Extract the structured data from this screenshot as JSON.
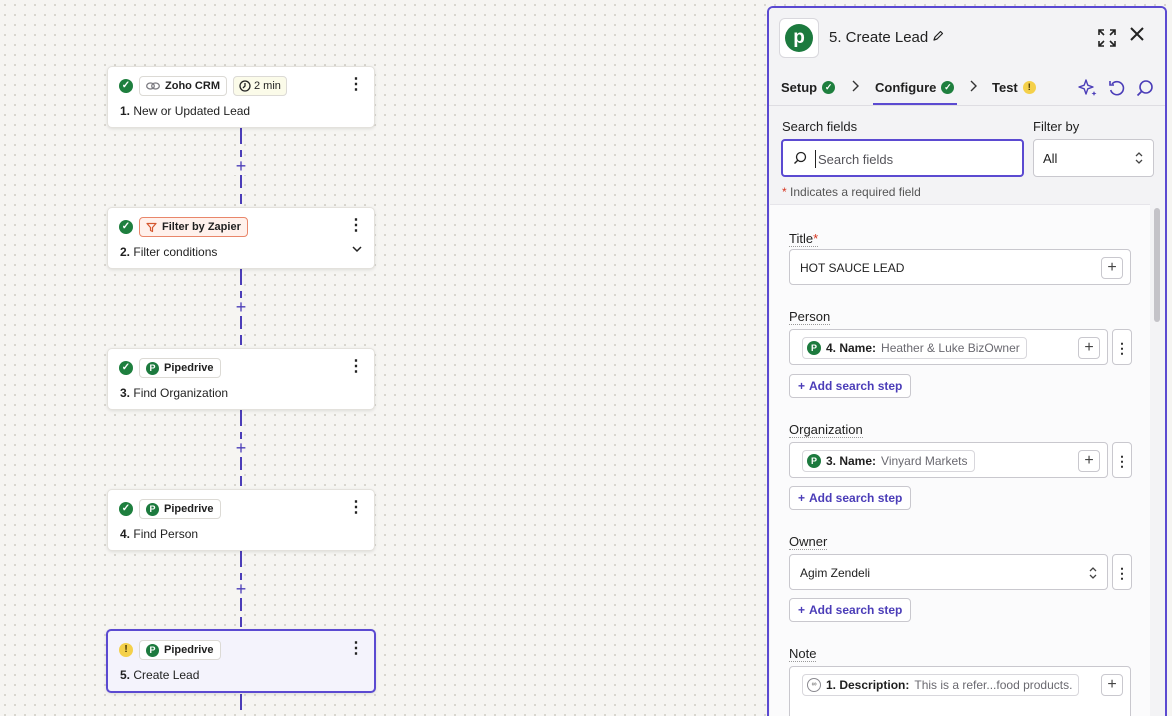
{
  "canvas": {
    "steps": [
      {
        "number": "1.",
        "title": "New or Updated Lead",
        "app": "Zoho CRM",
        "status": "ok",
        "extra": "2 min"
      },
      {
        "number": "2.",
        "title": "Filter conditions",
        "app": "Filter by Zapier",
        "status": "ok"
      },
      {
        "number": "3.",
        "title": "Find Organization",
        "app": "Pipedrive",
        "status": "ok"
      },
      {
        "number": "4.",
        "title": "Find Person",
        "app": "Pipedrive",
        "status": "ok"
      },
      {
        "number": "5.",
        "title": "Create Lead",
        "app": "Pipedrive",
        "status": "warning"
      }
    ],
    "add_step_symbol": "+",
    "kebab_symbol": "⋮"
  },
  "panel": {
    "title": "5. Create Lead",
    "tabs": [
      {
        "label": "Setup",
        "status": "ok"
      },
      {
        "label": "Configure",
        "status": "ok"
      },
      {
        "label": "Test",
        "status": "warning"
      }
    ],
    "search_label": "Search fields",
    "search_placeholder": "Search fields",
    "filter_label": "Filter by",
    "filter_value": "All",
    "required_note": "Indicates a required field",
    "required_star": "*",
    "fields": {
      "title": {
        "label": "Title",
        "value": "HOT SAUCE LEAD"
      },
      "person": {
        "label": "Person",
        "pill_key": "4. Name:",
        "pill_value": "Heather & Luke BizOwner"
      },
      "organization": {
        "label": "Organization",
        "pill_key": "3. Name:",
        "pill_value": "Vinyard Markets"
      },
      "owner": {
        "label": "Owner",
        "value": "Agim Zendeli"
      },
      "note": {
        "label": "Note",
        "pill_key": "1. Description:",
        "pill_value": "This is a refer...food products."
      }
    },
    "add_search_step": "Add search step"
  },
  "colors": {
    "accent": "#5b4ad1",
    "success": "#1e7f3e",
    "warning": "#f4d04a",
    "pipedrive": "#1c7a3e"
  }
}
